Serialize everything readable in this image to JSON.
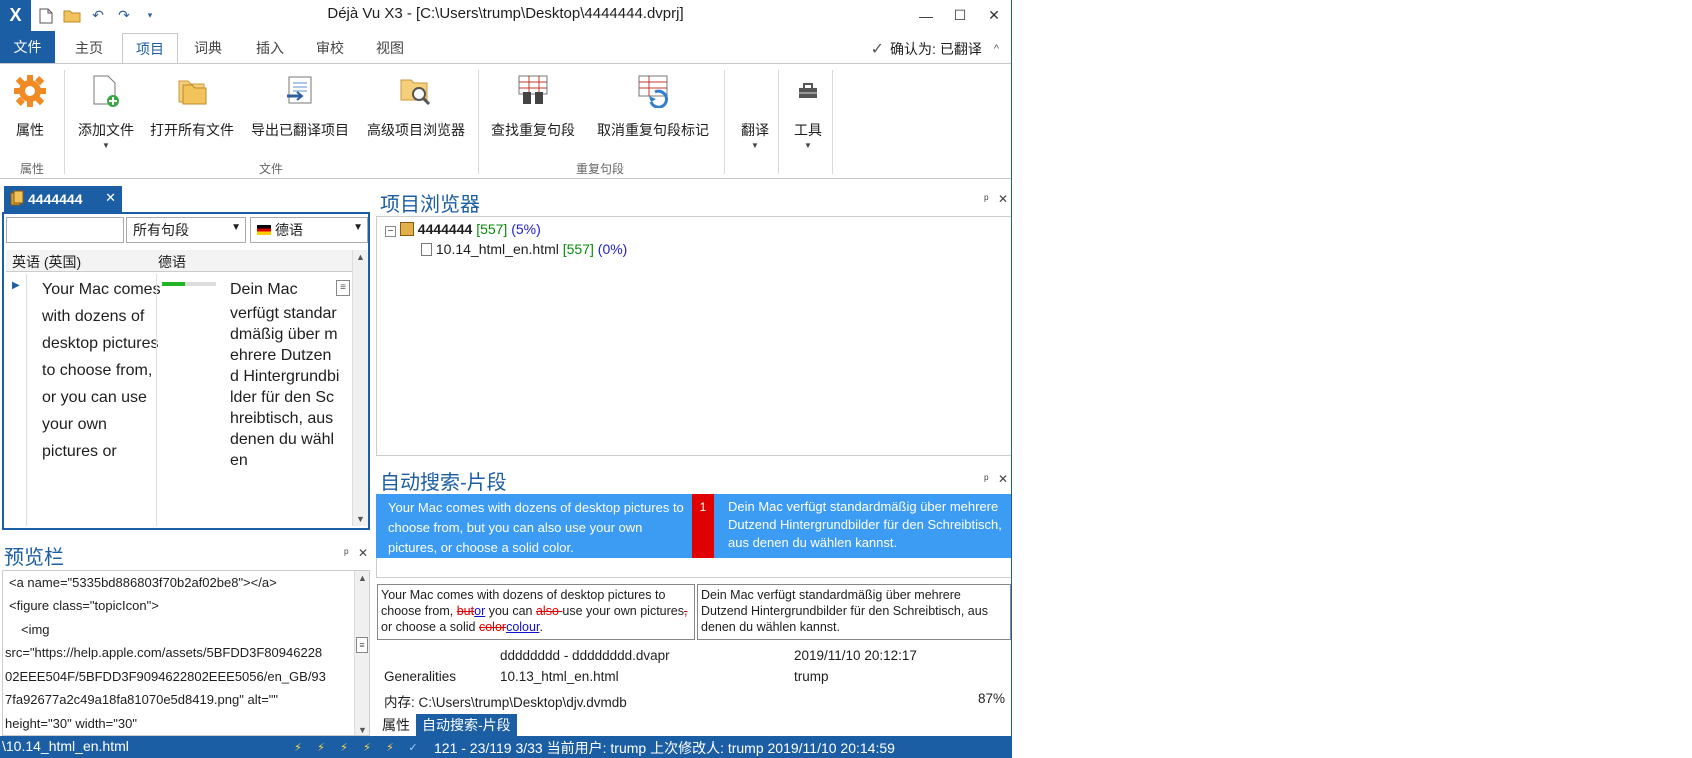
{
  "window": {
    "title": "Déjà Vu X3 - [C:\\Users\\trump\\Desktop\\4444444.dvprj]",
    "app_icon": "X",
    "controls": [
      "—",
      "☐",
      "✕"
    ]
  },
  "qat_icons": [
    "new-doc-icon",
    "open-folder-icon",
    "undo-icon",
    "redo-icon",
    "customize-qat-icon"
  ],
  "tabs": {
    "file": "文件",
    "items": [
      "主页",
      "项目",
      "词典",
      "插入",
      "审校",
      "视图"
    ],
    "active": "项目"
  },
  "confirm": {
    "label": "确认为: 已翻译",
    "check": "✓",
    "collapse": "^"
  },
  "ribbon": {
    "buttons": {
      "properties": "属性",
      "add_file": "添加文件",
      "open_all": "打开所有文件",
      "export": "导出已翻译项目",
      "advanced_browser": "高级项目浏览器",
      "find_dup": "查找重复句段",
      "cancel_dup": "取消重复句段标记",
      "translate": "翻译",
      "tools": "工具"
    },
    "groups": {
      "properties": "属性",
      "file": "文件",
      "dup": "重复句段"
    }
  },
  "doc_tab": {
    "label": "4444444",
    "close": "✕"
  },
  "filter": {
    "value": "",
    "segments": "所有句段",
    "language": "德语"
  },
  "grid": {
    "col_source": "英语 (英国)",
    "col_target": "德语",
    "row": {
      "source": "Your Mac comes with dozens of desktop pictures to choose from, or you can use your own pictures or",
      "target_first": "Dein Mac",
      "target_rest": "verfügt standardmäßig über mehrere Dutzend Hintergrundbilder für den Schreibtisch, aus denen du wählen",
      "progress": 0.42
    }
  },
  "preview": {
    "title": "预览栏",
    "lines": [
      "<a name=\"5335bd886803f70b2af02be8\"></a>",
      "<figure class=\"topicIcon\">",
      "<img",
      "src=\"https://help.apple.com/assets/5BFDD3F80946228",
      "02EEE504F/5BFDD3F9094622802EEE5056/en_GB/93",
      "7fa92677a2c49a18fa81070e5d8419.png\" alt=\"\"",
      "height=\"30\" width=\"30\""
    ]
  },
  "pane_controls": {
    "pin": "ᵖ",
    "close": "✕"
  },
  "project_browser": {
    "title": "项目浏览器",
    "root": {
      "name": "4444444",
      "count": "[557]",
      "pct": "(5%)"
    },
    "child": {
      "name": "10.14_html_en.html",
      "count": "[557]",
      "pct": "(0%)"
    }
  },
  "autosearch": {
    "title": "自动搜索-片段",
    "match": {
      "source": "Your Mac comes with dozens of desktop pictures to choose from, but you can also use your own pictures, or choose a solid color.",
      "number": "1",
      "target": "Dein Mac verfügt standardmäßig über mehrere Dutzend Hintergrundbilder für den Schreibtisch, aus denen du wählen kannst."
    },
    "diff": {
      "p1": "Your Mac comes with dozens of desktop pictures to choose from, ",
      "del1": "but",
      "ins1": "or",
      "p2": " you can ",
      "del2": "also ",
      "p3": "use your own pictures",
      "del3": ",",
      "p4": " or choose a solid ",
      "del4": "color",
      "ins2": "colour",
      "p5": ".",
      "target": "Dein Mac verfügt standardmäßig über mehrere Dutzend Hintergrundbilder für den Schreibtisch, aus denen du wählen kannst."
    },
    "info": {
      "pair": "dddddddd - dddddddd.dvapr",
      "date1": "2019/11/10 20:12:17",
      "subject": "Generalities",
      "file": "10.13_html_en.html",
      "user": "trump",
      "memory": "内存: C:\\Users\\trump\\Desktop\\djv.dvmdb",
      "score": "87%"
    }
  },
  "bottom_tabs": [
    "属性",
    "自动搜索-片段"
  ],
  "status": {
    "path": "\\10.14_html_en.html",
    "text": "121 - 23/119  3/33  当前用户: trump  上次修改人: trump  2019/11/10 20:14:59"
  },
  "colors": {
    "accent": "#1c5ea3",
    "match_band": "#3c9bf2",
    "match_number": "#e00000",
    "progress": "#22b422"
  }
}
